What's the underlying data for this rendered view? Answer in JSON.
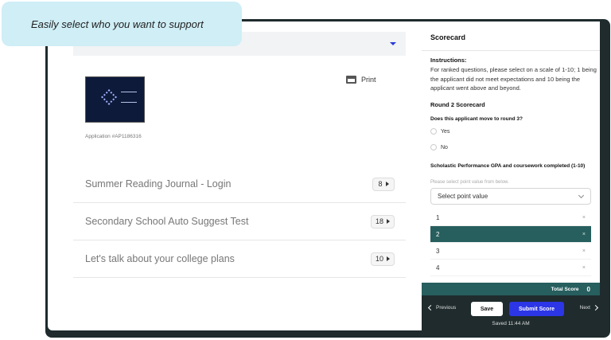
{
  "callout": {
    "text": "Easily select who you want to support"
  },
  "left": {
    "print_label": "Print",
    "application_id": "Application #AP1186316",
    "items": [
      {
        "label": "Summer Reading Journal - Login",
        "count": "8"
      },
      {
        "label": "Secondary School Auto Suggest Test",
        "count": "18"
      },
      {
        "label": "Let's talk about your college plans",
        "count": "10"
      }
    ]
  },
  "scorecard": {
    "title": "Scorecard",
    "instructions_heading": "Instructions:",
    "instructions": "For ranked questions, please select on a scale of 1-10; 1 being the applicant did not meet expectations and 10 being the applicant went above and beyond.",
    "round_title": "Round 2 Scorecard",
    "question1": "Does this applicant move to round 3?",
    "options_q1": [
      "Yes",
      "No"
    ],
    "question2": "Scholastic Performance GPA and coursework completed (1-10)",
    "hint": "Please select point value from below.",
    "select_placeholder": "Select point value",
    "point_options": [
      "1",
      "2",
      "3",
      "4"
    ],
    "selected_option": "2",
    "total_label": "Total Score",
    "total_value": "0"
  },
  "nav": {
    "previous": "Previous",
    "save": "Save",
    "submit": "Submit Score",
    "next": "Next",
    "saved_status": "Saved 11:44 AM"
  },
  "colors": {
    "accent": "#275e5e",
    "submit": "#2c36e6",
    "frame": "#1f2b2d",
    "callout": "#cfeef6"
  }
}
